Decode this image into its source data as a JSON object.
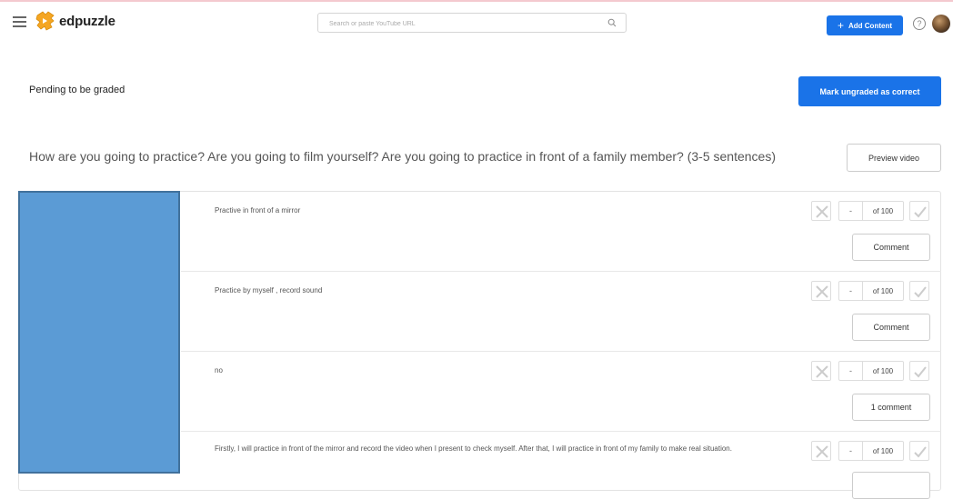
{
  "header": {
    "logo_text": "edpuzzle",
    "search_placeholder": "Search or paste YouTube URL",
    "add_content_label": "Add Content",
    "help_label": "?",
    "brand_color": "#1a73e8",
    "logo_color": "#f5a623"
  },
  "page": {
    "pending_label": "Pending to be graded",
    "mark_button_label": "Mark ungraded as correct",
    "question_text": "How are you going to practice? Are you going to film yourself? Are you going to practice in front of a family member? (3-5 sentences)",
    "preview_button_label": "Preview video"
  },
  "answers": [
    {
      "text": "Practive in front of a mirror",
      "grade_dash": "-",
      "grade_of": "of 100",
      "comment_label": "Comment"
    },
    {
      "text": "Practice by myself , record sound",
      "grade_dash": "-",
      "grade_of": "of 100",
      "comment_label": "Comment"
    },
    {
      "text": "no",
      "grade_dash": "-",
      "grade_of": "of 100",
      "comment_label": "1 comment"
    },
    {
      "text": "Firstly, I will practice in front of the mirror and record the video when I present to check myself. After that, I will practice in front of my family to make real situation.",
      "grade_dash": "-",
      "grade_of": "of 100",
      "comment_label": ""
    }
  ],
  "icons": {
    "menu": "hamburger-icon",
    "search": "search-icon",
    "plus": "plus-icon",
    "help": "help-icon",
    "incorrect": "close-icon",
    "correct": "check-icon"
  },
  "redaction_color": "#5b9bd5"
}
